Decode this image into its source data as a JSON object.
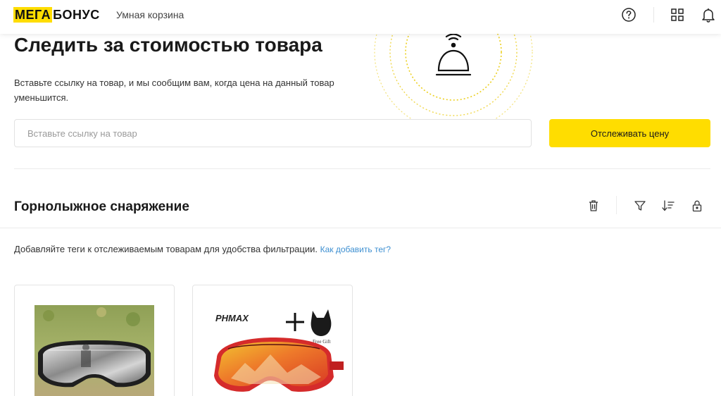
{
  "header": {
    "logo_part1": "МЕГА",
    "logo_part2": "БОНУС",
    "subtitle": "Умная корзина"
  },
  "hero": {
    "title": "Следить за стоимостью товара",
    "description": "Вставьте ссылку на товар, и мы сообщим вам, когда цена на данный товар уменьшится.",
    "input_placeholder": "Вставьте ссылку на товар",
    "input_value": "",
    "button_label": "Отслеживать цену"
  },
  "section": {
    "title": "Горнолыжное снаряжение",
    "tags_hint": "Добавляйте теги к отслеживаемым товарам для удобства фильтрации.",
    "tags_link": "Как добавить тег?"
  },
  "products": [
    {
      "image": "mirrored-ski-goggles-on-grass"
    },
    {
      "image": "phmax-ski-goggles-with-free-gift",
      "brand_text": "PHMAX",
      "gift_text": "Free Gift"
    }
  ],
  "colors": {
    "brand_yellow": "#ffdd00",
    "link_blue": "#3d8fd1",
    "border": "#e4e4e4"
  },
  "icons": {
    "help": "question-circle-icon",
    "apps": "grid-icon",
    "notifications": "bell-icon",
    "delete": "trash-icon",
    "filter": "filter-icon",
    "sort": "sort-icon",
    "lock": "lock-icon",
    "decor": "service-bell-icon"
  }
}
